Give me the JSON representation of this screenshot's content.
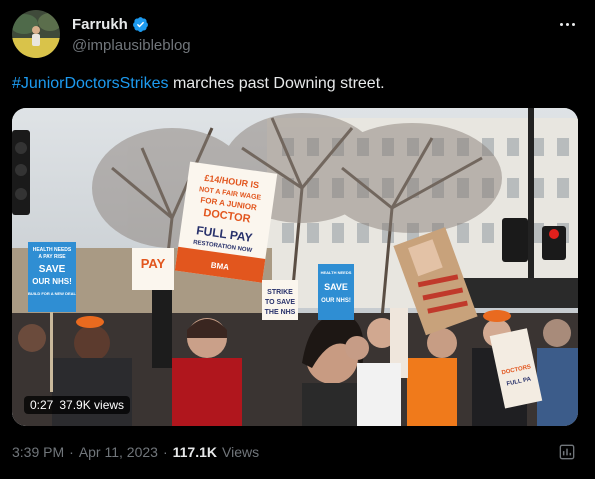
{
  "author": {
    "display_name": "Farrukh",
    "handle": "@implausibleblog",
    "verified_color": "#1d9bf0",
    "avatar_icon": "avatar-photo"
  },
  "tweet": {
    "hashtag": "#JuniorDoctorsStrikes",
    "text": " marches past Downing street."
  },
  "media": {
    "duration": "0:27",
    "view_count": "37.9K views",
    "placard_main": {
      "line1": "£14/HOUR IS",
      "line2": "NOT A FAIR WAGE",
      "line3": "FOR A JUNIOR",
      "line4": "DOCTOR",
      "line5": "FULL PAY",
      "line6": "RESTORATION NOW",
      "logo": "BMA"
    },
    "placard_left": {
      "line1": "HEALTH NEEDS",
      "line2": "A PAY RISE",
      "line3": "SAVE",
      "line4": "OUR NHS!",
      "line5": "BUILD FOR A NEW DEAL"
    },
    "placard_pay": "PAY",
    "placard_strike": {
      "line1": "STRIKE",
      "line2": "TO SAVE",
      "line3": "THE NHS"
    },
    "placard_right": {
      "line1": "HEALTH NEEDS",
      "line2": "SAVE",
      "line3": "OUR NHS!"
    },
    "placard_bottom_right": {
      "line1": "DOCTORS",
      "line2": "FULL PA"
    }
  },
  "footer": {
    "time": "3:39 PM",
    "separator": "·",
    "date": "Apr 11, 2023",
    "views_number": "117.1K",
    "views_label": "Views"
  },
  "colors": {
    "background": "#000000",
    "text": "#e7e9ea",
    "muted": "#71767b",
    "link": "#1d9bf0"
  }
}
